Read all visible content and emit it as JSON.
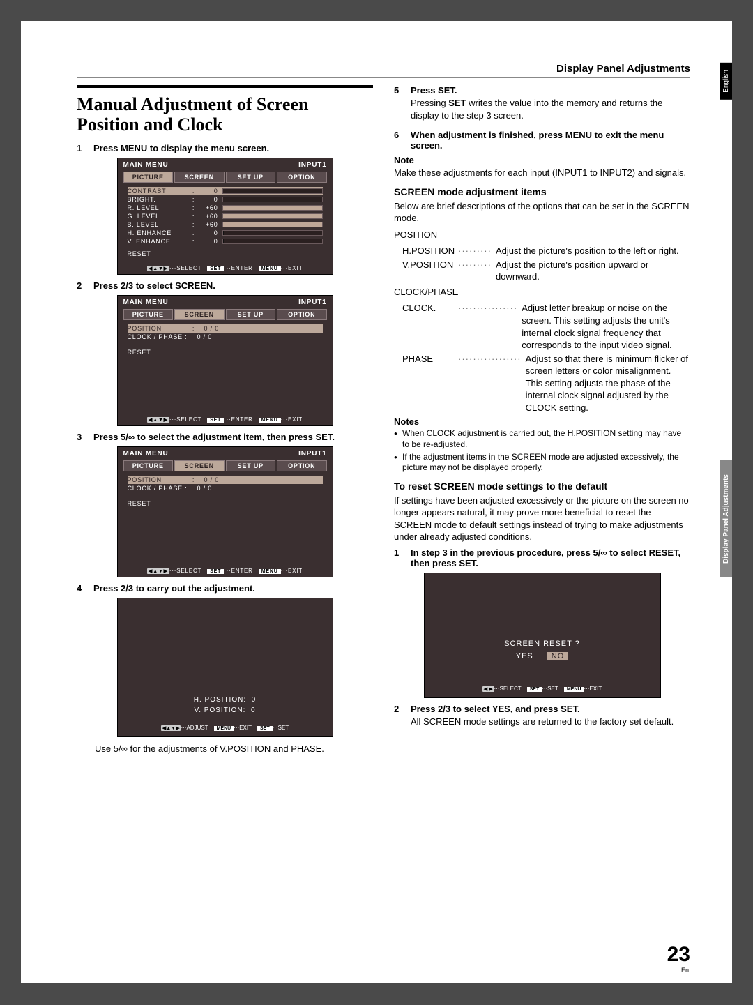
{
  "header": {
    "section": "Display Panel Adjustments",
    "lang": "English",
    "side": "Display Panel Adjustments"
  },
  "title": "Manual Adjustment of Screen Position and Clock",
  "left": {
    "step1": "Press MENU to display the menu screen.",
    "step2": "Press 2/3 to select SCREEN.",
    "step3": "Press 5/∞ to select the adjustment item, then press SET.",
    "step4": "Press 2/3 to carry out the adjustment.",
    "caption4": "Use 5/∞ for the adjustments of V.POSITION and PHASE."
  },
  "right": {
    "step5": "Press SET.",
    "step5b": "Pressing <b>SET</b> writes the value into the memory and returns the display to the step 3 screen.",
    "step6": "When adjustment is finished, press MENU to exit the menu screen.",
    "note_h": "Note",
    "note_t": "Make these adjustments for each input (INPUT1 to INPUT2) and signals.",
    "screen_h": "SCREEN mode adjustment items",
    "screen_t": "Below are brief descriptions of the options that can be set in the SCREEN mode.",
    "pos_h": "POSITION",
    "hpos_l": "H.POSITION",
    "hpos_v": "Adjust the picture's position to the left or right.",
    "vpos_l": "V.POSITION",
    "vpos_v": "Adjust the picture's position upward or downward.",
    "clk_h": "CLOCK/PHASE",
    "clk_l": "CLOCK.",
    "clk_v": "Adjust letter breakup or noise on the screen. This setting adjusts the unit's internal clock signal frequency that corresponds to the input video signal.",
    "ph_l": "PHASE",
    "ph_v": "Adjust so that there is minimum flicker of screen letters or color misalignment. This setting adjusts the phase of the internal clock signal adjusted by the CLOCK setting.",
    "notes_h": "Notes",
    "note1": "When CLOCK adjustment is carried out, the H.POSITION setting may have to be re-adjusted.",
    "note2": "If the adjustment items in the SCREEN mode are adjusted excessively, the picture may not be displayed properly.",
    "reset_h": "To reset SCREEN mode settings to the default",
    "reset_t": "If settings have been adjusted excessively or the picture on the screen no longer appears natural, it may prove more beneficial to reset the SCREEN mode to default settings instead of trying to make adjustments under already adjusted conditions.",
    "rstep1": "In step 3 in the previous procedure, press 5/∞ to select RESET, then press SET.",
    "rstep2": "Press 2/3 to select YES, and press SET.",
    "rstep2b": "All SCREEN mode settings are returned to the factory set default."
  },
  "osd": {
    "menu_title": "MAIN  MENU",
    "input": "INPUT1",
    "tabs": [
      "PICTURE",
      "SCREEN",
      "SET UP",
      "OPTION"
    ],
    "pic": {
      "contrast": "CONTRAST",
      "contrast_v": "0",
      "bright": "BRIGHT.",
      "bright_v": "0",
      "rlevel": "R. LEVEL",
      "rlevel_v": "+60",
      "glevel": "G. LEVEL",
      "glevel_v": "+60",
      "blevel": "B. LEVEL",
      "blevel_v": "+60",
      "henh": "H. ENHANCE",
      "henh_v": "0",
      "venh": "V. ENHANCE",
      "venh_v": "0",
      "reset": "RESET"
    },
    "scr": {
      "position": "POSITION",
      "pos_v": "0 /      0",
      "clock": "CLOCK / PHASE :",
      "clk_v": "0 /      0",
      "reset": "RESET"
    },
    "pos_adj": {
      "h": "H. POSITION:",
      "hv": "0",
      "v": "V. POSITION:",
      "vv": "0"
    },
    "reset_box": {
      "t": "SCREEN    RESET  ?",
      "yes": "YES",
      "no": "NO"
    },
    "footer": {
      "select": "SELECT",
      "enter": "ENTER",
      "exit": "EXIT",
      "adjust": "ADJUST",
      "set": "SET",
      "set_btn": "SET",
      "menu_btn": "MENU"
    }
  },
  "page": {
    "num": "23",
    "sub": "En"
  }
}
